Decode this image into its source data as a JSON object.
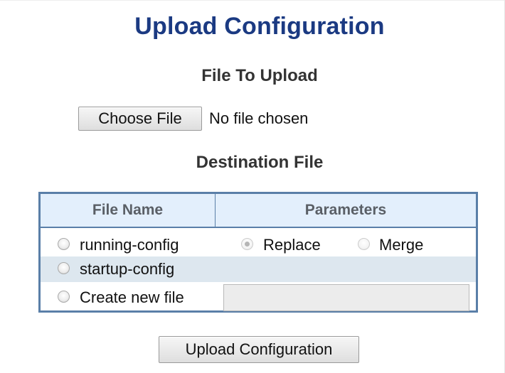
{
  "page": {
    "title": "Upload Configuration"
  },
  "upload": {
    "heading": "File To Upload",
    "choose_button": "Choose File",
    "status": "No file chosen"
  },
  "destination": {
    "heading": "Destination File",
    "columns": [
      "File Name",
      "Parameters"
    ],
    "rows": [
      {
        "label": "running-config",
        "selected": false
      },
      {
        "label": "startup-config",
        "selected": false
      },
      {
        "label": "Create new file",
        "selected": false,
        "input_value": ""
      }
    ],
    "parameters": [
      {
        "label": "Replace",
        "selected": true,
        "disabled": true
      },
      {
        "label": "Merge",
        "selected": false,
        "disabled": true
      }
    ]
  },
  "actions": {
    "submit": "Upload Configuration"
  },
  "colors": {
    "title": "#1b3a82",
    "table_border": "#5a7fa8",
    "header_bg": "#e3effc",
    "alt_row_bg": "#dde7ef"
  }
}
